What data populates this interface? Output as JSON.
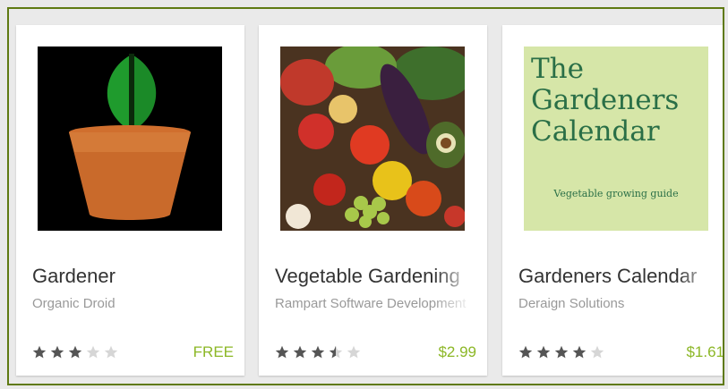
{
  "apps": [
    {
      "title": "Gardener",
      "developer": "Organic Droid",
      "rating": 3,
      "price": "FREE",
      "icon": "potted-plant-icon"
    },
    {
      "title": "Vegetable Gardening",
      "developer": "Rampart Software Development",
      "rating": 3.5,
      "price": "$2.99",
      "icon": "vegetables-photo"
    },
    {
      "title": "Gardeners Calendar",
      "developer": "Deraign Solutions",
      "rating": 4,
      "price": "$1.61",
      "icon": "calendar-cover"
    }
  ],
  "calendar_cover": {
    "line1": "The",
    "line2": "Gardeners",
    "line3": "Calendar",
    "subtitle": "Vegetable growing guide"
  },
  "colors": {
    "price_green": "#8cb726",
    "star_filled": "#555555",
    "star_empty": "#d6d6d6",
    "frame_border": "#5f7a12"
  }
}
